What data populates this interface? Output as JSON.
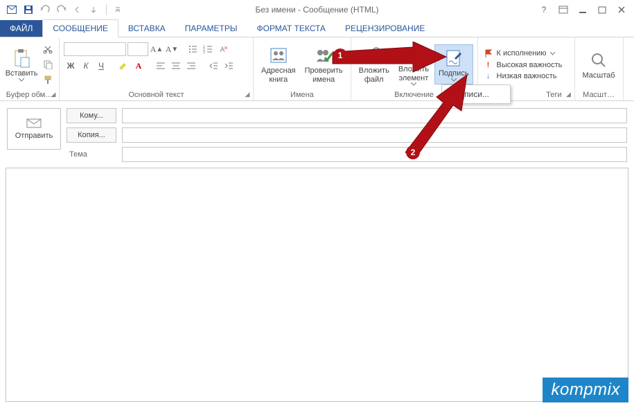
{
  "window": {
    "title": "Без имени - Сообщение (HTML)"
  },
  "tabs": {
    "file": "ФАЙЛ",
    "message": "СООБЩЕНИЕ",
    "insert": "ВСТАВКА",
    "options": "ПАРАМЕТРЫ",
    "format": "ФОРМАТ ТЕКСТА",
    "review": "РЕЦЕНЗИРОВАНИЕ"
  },
  "ribbon": {
    "clipboard": {
      "paste": "Вставить",
      "label": "Буфер обм…"
    },
    "font": {
      "bold": "Ж",
      "italic": "К",
      "underline": "Ч",
      "label": "Основной текст"
    },
    "names": {
      "addressbook_l1": "Адресная",
      "addressbook_l2": "книга",
      "checknames_l1": "Проверить",
      "checknames_l2": "имена",
      "label": "Имена"
    },
    "include": {
      "attachfile_l1": "Вложить",
      "attachfile_l2": "файл",
      "attachitem_l1": "Вложить",
      "attachitem_l2": "элемент",
      "signature": "Подпись",
      "label": "Включение",
      "dropdown": {
        "signatures": "Подписи..."
      }
    },
    "tags": {
      "followup": "К исполнению",
      "high": "Высокая важность",
      "low": "Низкая важность",
      "label": "Теги"
    },
    "zoom": {
      "btn": "Масштаб",
      "label": "Масшт…"
    }
  },
  "compose": {
    "send": "Отправить",
    "to": "Кому...",
    "cc": "Копия...",
    "subject": "Тема"
  },
  "callouts": {
    "one": "1",
    "two": "2"
  },
  "watermark": "kompmix"
}
